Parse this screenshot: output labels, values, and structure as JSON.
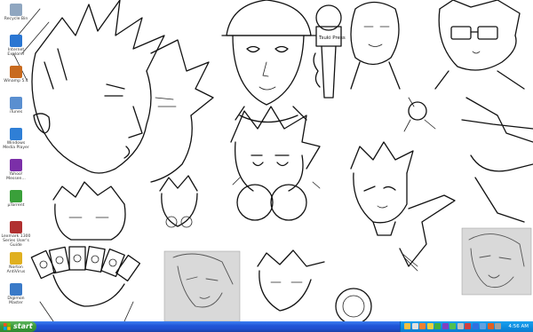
{
  "desktop": {
    "icons": [
      {
        "label": "Recycle Bin",
        "icon": "recycle-bin-icon",
        "color": "#8fa6c0"
      },
      {
        "label": "Internet Explorer",
        "icon": "internet-explorer-icon",
        "color": "#2a76d2"
      },
      {
        "label": "Winamp 5.4",
        "icon": "winamp-icon",
        "color": "#c86a1e"
      },
      {
        "label": "iTunes",
        "icon": "itunes-icon",
        "color": "#5a8fd0"
      },
      {
        "label": "Windows Media Player",
        "icon": "media-player-icon",
        "color": "#2f7fd6"
      },
      {
        "label": "Yahoo! Messen...",
        "icon": "yahoo-messenger-icon",
        "color": "#7b2fa8"
      },
      {
        "label": "µTorrent",
        "icon": "utorrent-icon",
        "color": "#3aa03a"
      },
      {
        "label": "Lexmark 1300 Series User's Guide",
        "icon": "lexmark-guide-icon",
        "color": "#b03030"
      },
      {
        "label": "Norton AntiVirus",
        "icon": "norton-antivirus-icon",
        "color": "#e0b020"
      },
      {
        "label": "Digimon Master",
        "icon": "digimon-master-icon",
        "color": "#3a7ac8"
      }
    ],
    "sign_text": "Tsuki Press"
  },
  "taskbar": {
    "start_label": "start",
    "clock": "4:56 AM",
    "tray_icons": [
      {
        "icon": "tray-network-icon",
        "color": "#f0c040"
      },
      {
        "icon": "tray-volume-icon",
        "color": "#e0e0e0"
      },
      {
        "icon": "tray-messenger-icon",
        "color": "#f08030"
      },
      {
        "icon": "tray-antivirus-icon",
        "color": "#e8d040"
      },
      {
        "icon": "tray-update-icon",
        "color": "#40b040"
      },
      {
        "icon": "tray-yahoo-icon",
        "color": "#8040c0"
      },
      {
        "icon": "tray-torrent-icon",
        "color": "#50c050"
      },
      {
        "icon": "tray-printer-icon",
        "color": "#c0c0c0"
      },
      {
        "icon": "tray-security-icon",
        "color": "#d04040"
      },
      {
        "icon": "tray-bluetooth-icon",
        "color": "#3070e0"
      },
      {
        "icon": "tray-display-icon",
        "color": "#60a0e0"
      },
      {
        "icon": "tray-shield-icon",
        "color": "#e06020"
      },
      {
        "icon": "tray-power-icon",
        "color": "#a0a0a0"
      }
    ]
  }
}
